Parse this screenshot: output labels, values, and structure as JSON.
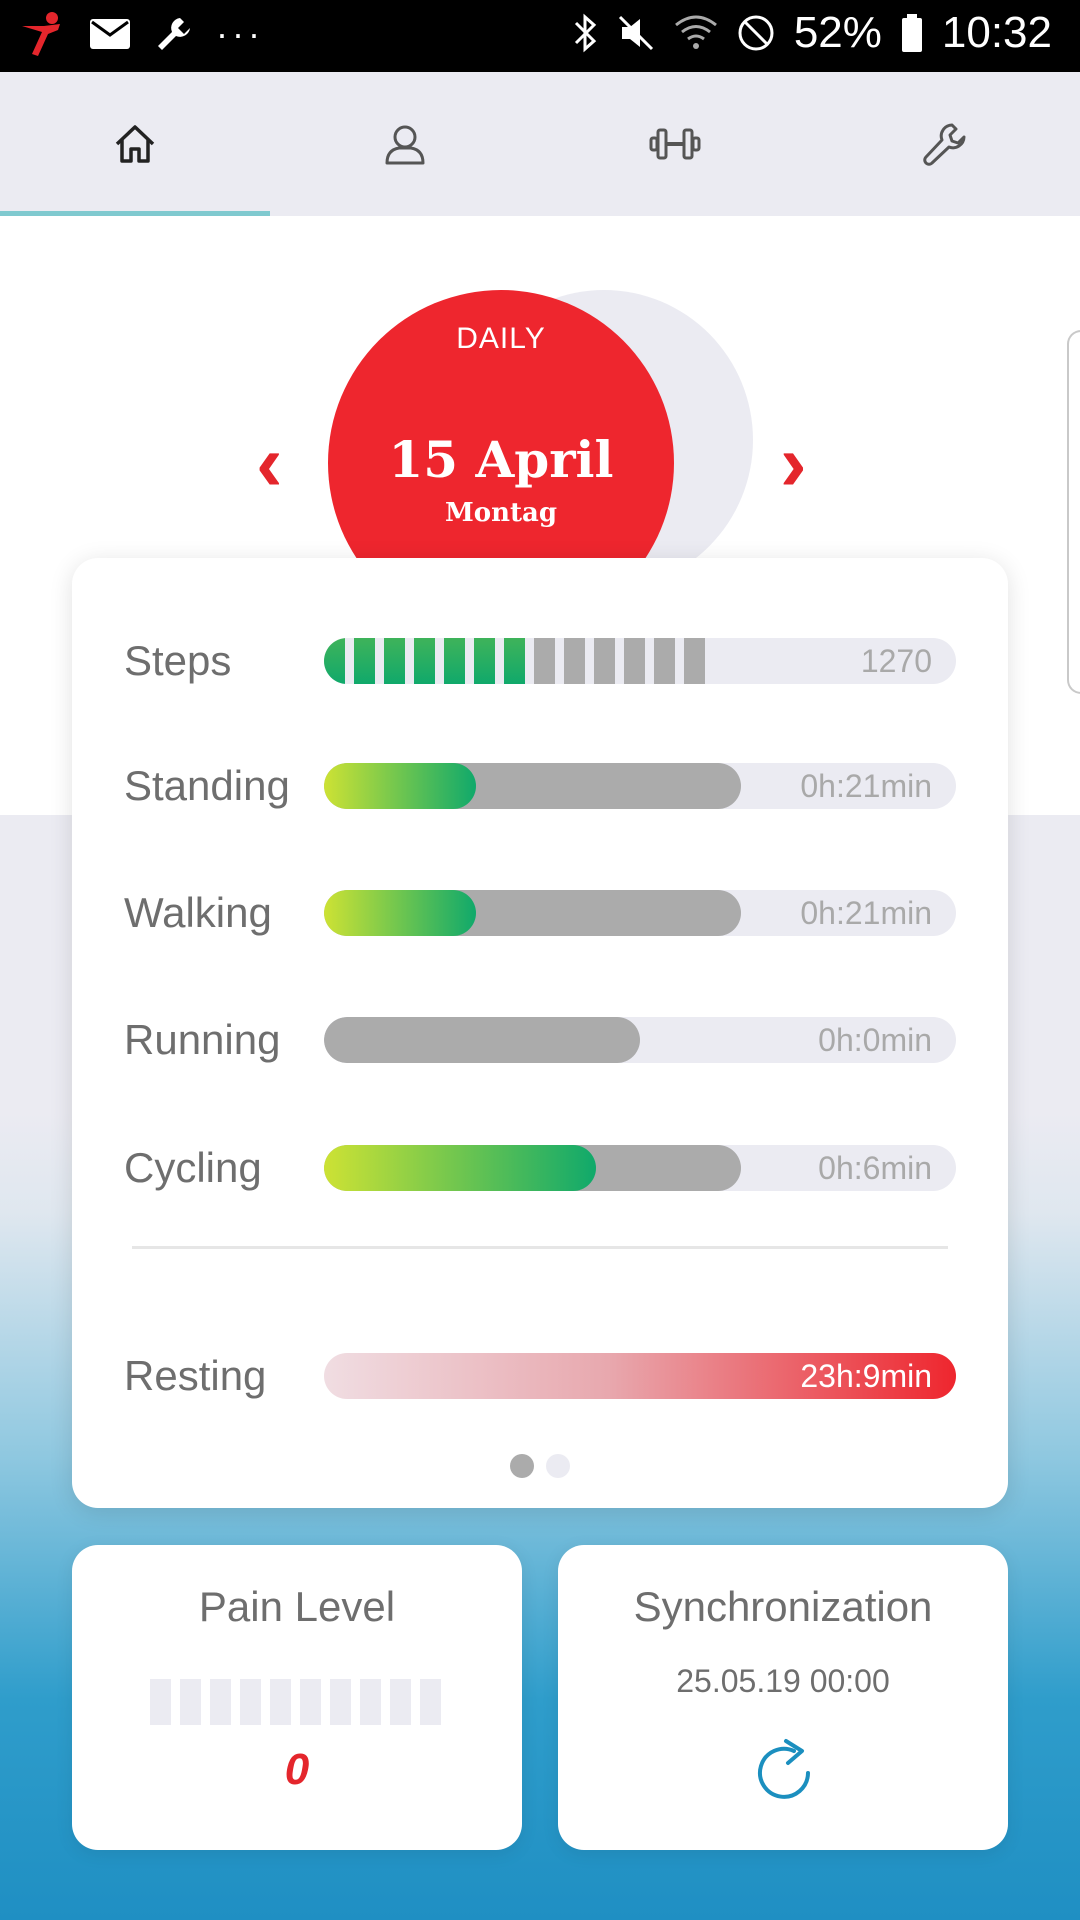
{
  "status_bar": {
    "icons": [
      "app-runner-icon",
      "mail-icon",
      "wrench-icon",
      "more-icon",
      "bluetooth-icon",
      "mute-icon",
      "wifi-icon",
      "dnd-icon",
      "battery-icon"
    ],
    "more": "···",
    "battery": "52%",
    "time": "10:32"
  },
  "tabs": [
    {
      "icon": "home-icon",
      "active": true
    },
    {
      "icon": "user-icon",
      "active": false
    },
    {
      "icon": "dumbbell-icon",
      "active": false
    },
    {
      "icon": "wrench-icon",
      "active": false
    }
  ],
  "date_selector": {
    "period": "DAILY",
    "date": "15 April",
    "weekday": "Montag",
    "prev": "‹",
    "next": "›"
  },
  "activities": {
    "steps": {
      "label": "Steps",
      "value": "1270",
      "segments_total": 13,
      "segments_green": 7
    },
    "standing": {
      "label": "Standing",
      "value": "0h:21min",
      "goal_fraction": 0.66,
      "progress_fraction": 0.24
    },
    "walking": {
      "label": "Walking",
      "value": "0h:21min",
      "goal_fraction": 0.66,
      "progress_fraction": 0.24
    },
    "running": {
      "label": "Running",
      "value": "0h:0min",
      "goal_fraction": 0.5,
      "progress_fraction": 0.0
    },
    "cycling": {
      "label": "Cycling",
      "value": "0h:6min",
      "goal_fraction": 0.66,
      "progress_fraction": 0.43
    },
    "resting": {
      "label": "Resting",
      "value": "23h:9min"
    }
  },
  "pager": {
    "pages": 2,
    "current": 1
  },
  "pain_level": {
    "title": "Pain Level",
    "value": "0",
    "segments_total": 10
  },
  "sync": {
    "title": "Synchronization",
    "date": "25.05.19 00:00"
  },
  "colors": {
    "brand_red": "#ee262e",
    "green_start": "#cde234",
    "green_end": "#10a96b",
    "track": "#ebebf2",
    "goal_grey": "#ababab",
    "tab_indicator": "#7fc9cf",
    "sync_blue": "#1b8fbf"
  }
}
